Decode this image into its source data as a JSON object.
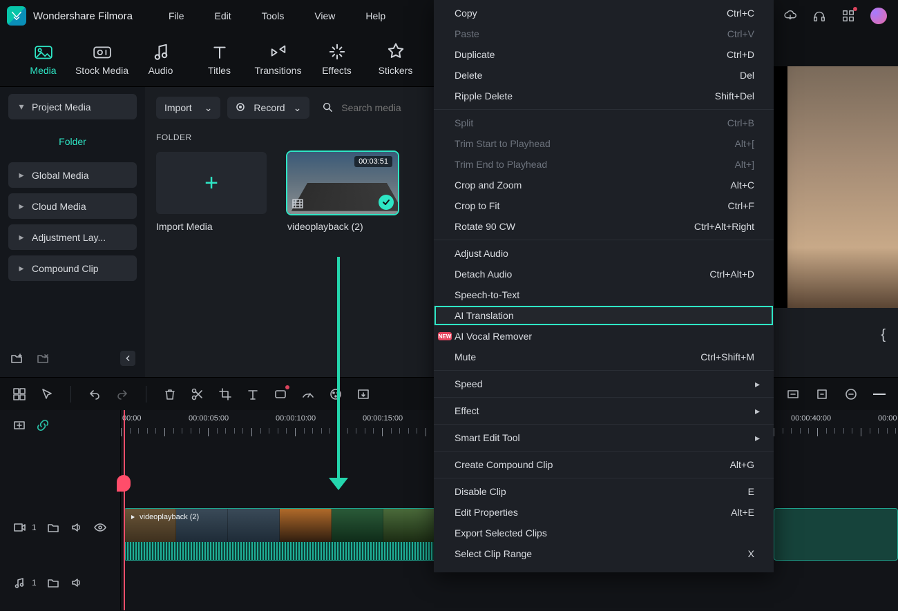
{
  "app_name": "Wondershare Filmora",
  "menubar": [
    "File",
    "Edit",
    "Tools",
    "View",
    "Help"
  ],
  "tooltabs": [
    {
      "label": "Media",
      "active": true
    },
    {
      "label": "Stock Media"
    },
    {
      "label": "Audio"
    },
    {
      "label": "Titles"
    },
    {
      "label": "Transitions"
    },
    {
      "label": "Effects"
    },
    {
      "label": "Stickers"
    }
  ],
  "sidebar": {
    "project_media": "Project Media",
    "folder": "Folder",
    "items": [
      "Global Media",
      "Cloud Media",
      "Adjustment Lay...",
      "Compound Clip"
    ]
  },
  "content": {
    "import_label": "Import",
    "record_label": "Record",
    "search_placeholder": "Search media",
    "folder_heading": "FOLDER",
    "import_tile": "Import Media",
    "clip_name": "videoplayback (2)",
    "clip_duration": "00:03:51"
  },
  "timeline": {
    "ruler": [
      "00:00",
      "00:00:05:00",
      "00:00:10:00",
      "00:00:15:00",
      "00:00:40:00",
      "00:00"
    ],
    "clip_label": "videoplayback (2)",
    "video_track_count": "1",
    "audio_track_count": "1"
  },
  "context_menu": {
    "groups": [
      [
        {
          "label": "Copy",
          "shortcut": "Ctrl+C"
        },
        {
          "label": "Paste",
          "shortcut": "Ctrl+V",
          "disabled": true
        },
        {
          "label": "Duplicate",
          "shortcut": "Ctrl+D"
        },
        {
          "label": "Delete",
          "shortcut": "Del"
        },
        {
          "label": "Ripple Delete",
          "shortcut": "Shift+Del"
        }
      ],
      [
        {
          "label": "Split",
          "shortcut": "Ctrl+B",
          "disabled": true
        },
        {
          "label": "Trim Start to Playhead",
          "shortcut": "Alt+[",
          "disabled": true
        },
        {
          "label": "Trim End to Playhead",
          "shortcut": "Alt+]",
          "disabled": true
        },
        {
          "label": "Crop and Zoom",
          "shortcut": "Alt+C"
        },
        {
          "label": "Crop to Fit",
          "shortcut": "Ctrl+F"
        },
        {
          "label": "Rotate 90 CW",
          "shortcut": "Ctrl+Alt+Right"
        }
      ],
      [
        {
          "label": "Adjust Audio"
        },
        {
          "label": "Detach Audio",
          "shortcut": "Ctrl+Alt+D"
        },
        {
          "label": "Speech-to-Text"
        },
        {
          "label": "AI Translation",
          "highlight": true
        },
        {
          "label": "AI Vocal Remover",
          "badge": "NEW"
        },
        {
          "label": "Mute",
          "shortcut": "Ctrl+Shift+M"
        }
      ],
      [
        {
          "label": "Speed",
          "submenu": true
        }
      ],
      [
        {
          "label": "Effect",
          "submenu": true
        }
      ],
      [
        {
          "label": "Smart Edit Tool",
          "submenu": true
        }
      ],
      [
        {
          "label": "Create Compound Clip",
          "shortcut": "Alt+G"
        }
      ],
      [
        {
          "label": "Disable Clip",
          "shortcut": "E"
        },
        {
          "label": "Edit Properties",
          "shortcut": "Alt+E"
        },
        {
          "label": "Export Selected Clips"
        },
        {
          "label": "Select Clip Range",
          "shortcut": "X"
        }
      ]
    ]
  }
}
